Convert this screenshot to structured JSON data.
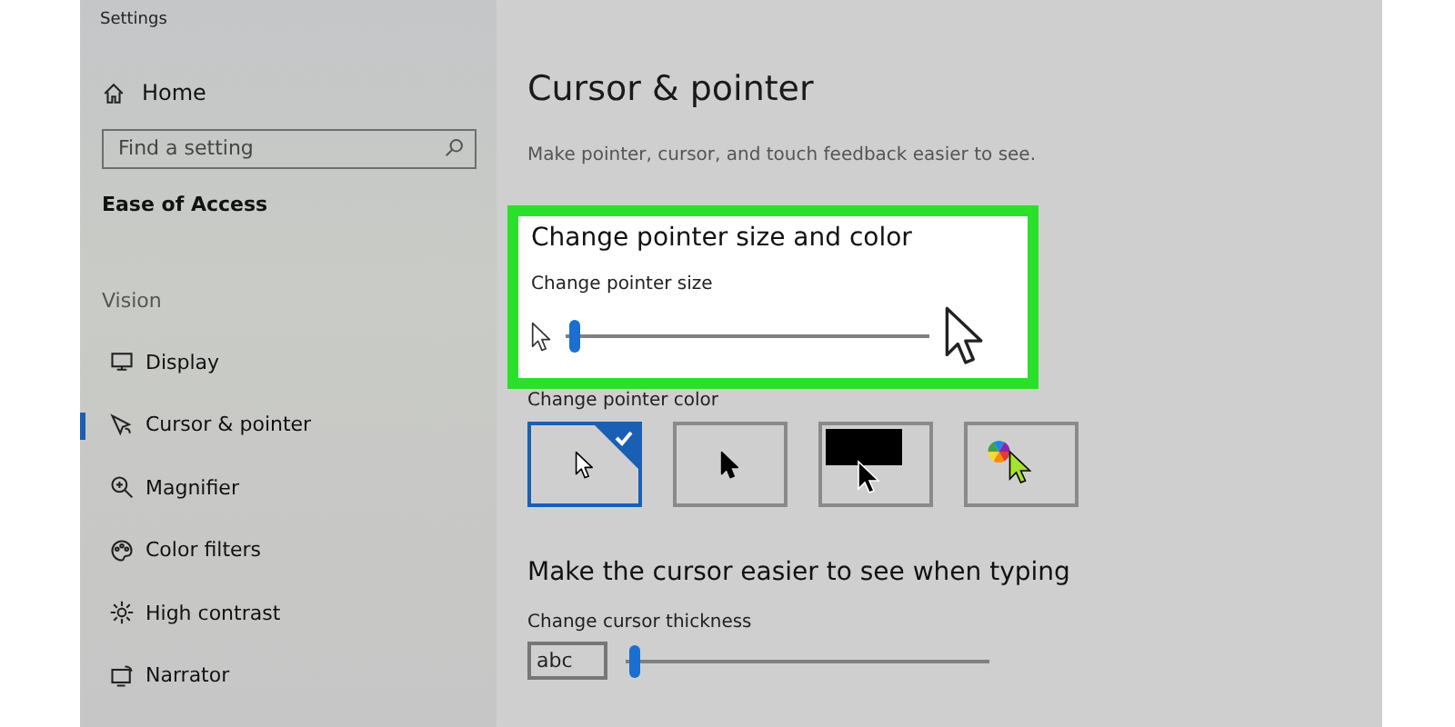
{
  "window": {
    "title": "Settings"
  },
  "sidebar": {
    "home": "Home",
    "search": {
      "placeholder": "Find a setting"
    },
    "section": "Ease of Access",
    "group": "Vision",
    "items": [
      {
        "label": "Display",
        "kind": "display",
        "selected": false
      },
      {
        "label": "Cursor & pointer",
        "kind": "cursor",
        "selected": true
      },
      {
        "label": "Magnifier",
        "kind": "magnifier",
        "selected": false
      },
      {
        "label": "Color filters",
        "kind": "palette",
        "selected": false
      },
      {
        "label": "High contrast",
        "kind": "sun",
        "selected": false
      },
      {
        "label": "Narrator",
        "kind": "narrator",
        "selected": false
      }
    ]
  },
  "main": {
    "title": "Cursor & pointer",
    "description": "Make pointer, cursor, and touch feedback easier to see.",
    "pointer_size": {
      "heading": "Change pointer size and color",
      "label": "Change pointer size",
      "level": 0.01
    },
    "pointer_color": {
      "label": "Change pointer color",
      "options": [
        {
          "kind": "white",
          "selected": true
        },
        {
          "kind": "black",
          "selected": false
        },
        {
          "kind": "inverted",
          "selected": false
        },
        {
          "kind": "custom",
          "selected": false
        }
      ]
    },
    "typing": {
      "heading": "Make the cursor easier to see when typing",
      "label": "Change cursor thickness",
      "preview": "abc",
      "level": 0.01
    }
  }
}
